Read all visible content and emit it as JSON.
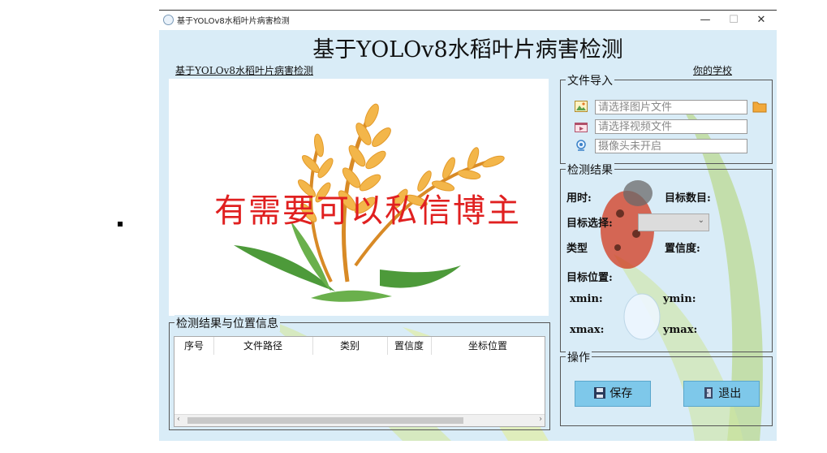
{
  "window": {
    "title": "基于YOLOv8水稻叶片病害检测",
    "minimize": "—",
    "maximize": "☐",
    "close": "✕"
  },
  "header": {
    "headline": "基于YOLOv8水稻叶片病害检测",
    "sublink": "基于YOLOv8水稻叶片病害检测",
    "school": "你的学校"
  },
  "watermark": "有需要可以私信博主",
  "file_import": {
    "title": "文件导入",
    "image_placeholder": "请选择图片文件",
    "video_placeholder": "请选择视频文件",
    "camera_placeholder": "摄像头未开启"
  },
  "results": {
    "title": "检测结果",
    "time_label": "用时:",
    "count_label": "目标数目:",
    "select_label": "目标选择:",
    "type_label": "类型",
    "conf_label": "置信度:",
    "pos_label": "目标位置:",
    "xmin": "xmin:",
    "ymin": "ymin:",
    "xmax": "xmax:",
    "ymax": "ymax:"
  },
  "table": {
    "title": "检测结果与位置信息",
    "columns": [
      "序号",
      "文件路径",
      "类别",
      "置信度",
      "坐标位置"
    ]
  },
  "ops": {
    "title": "操作",
    "save": "保存",
    "exit": "退出"
  },
  "colors": {
    "accent": "#7ec8ea",
    "watermark": "#e02020",
    "panel": "#d9ecf7"
  }
}
